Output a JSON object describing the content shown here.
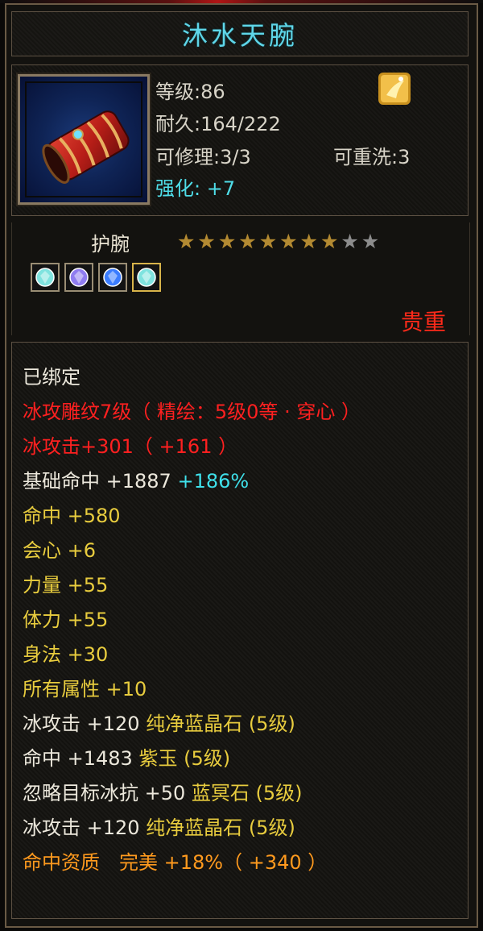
{
  "item": {
    "name": "沐水天腕",
    "level_text": "等级:86",
    "durability_text": "耐久:164/222",
    "repair_text": "可修理:3/3",
    "rewash_text": "可重洗:3",
    "enhance_text": "强化: +7",
    "type": "护腕",
    "stars_total": 10,
    "stars_filled": 8,
    "rarity": "贵重"
  },
  "gems": [
    {
      "icon": "cyan-gem-icon",
      "color": "#7fe3df"
    },
    {
      "icon": "purple-gem-icon",
      "color": "#8f7cf0"
    },
    {
      "icon": "blue-gem-icon",
      "color": "#3a7cff"
    },
    {
      "icon": "cyan-gem-icon",
      "color": "#7fe3df"
    }
  ],
  "attributes": {
    "bound": "已绑定",
    "engrave": "冰攻雕纹7级（ 精绘：5级0等 · 穿心 ）",
    "ice_attack": "冰攻击+301（ +161 ）",
    "base_hit": "基础命中 +1887",
    "base_hit_pct": "+186%",
    "hit": "命中 +580",
    "crit": "会心 +6",
    "strength": "力量 +55",
    "stamina": "体力 +55",
    "agility": "身法 +30",
    "all_attr": "所有属性 +10",
    "gem1_stat": "冰攻击 +120",
    "gem1_name": "纯净蓝晶石 (5级)",
    "gem2_stat": "命中 +1483",
    "gem2_name": "紫玉 (5级)",
    "gem3_stat": "忽略目标冰抗 +50",
    "gem3_name": "蓝冥石 (5级)",
    "gem4_stat": "冰攻击 +120",
    "gem4_name": "纯净蓝晶石 (5级)",
    "aptitude": "命中资质　完美 +18%（ +340 ）"
  },
  "colors": {
    "title": "#5fd6e8",
    "stat_red": "#ff2020",
    "stat_yellow": "#e8cc3e",
    "stat_cyan": "#3fe0ea",
    "stat_orange": "#ff9a1e",
    "rarity": "#ff2a1a"
  }
}
